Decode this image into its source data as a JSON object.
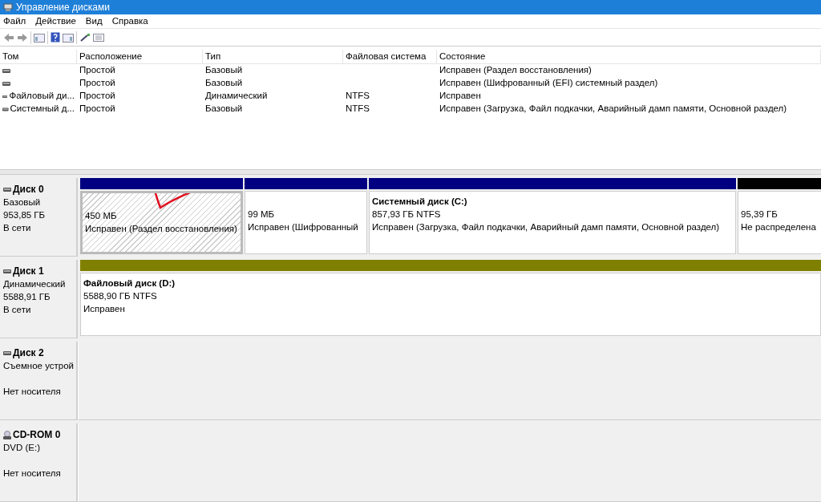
{
  "window": {
    "title": "Управление дисками"
  },
  "menu": [
    "Файл",
    "Действие",
    "Вид",
    "Справка"
  ],
  "table": {
    "columns": [
      "Том",
      "Расположение",
      "Тип",
      "Файловая система",
      "Состояние"
    ],
    "rows": [
      {
        "cells": [
          null,
          "Простой",
          "Базовый",
          null,
          "Исправен (Раздел восстановления)"
        ]
      },
      {
        "cells": [
          null,
          "Простой",
          "Базовый",
          null,
          "Исправен (Шифрованный (EFI) системный раздел)"
        ]
      },
      {
        "cells": [
          "Файловый ди...",
          "Простой",
          "Динамический",
          "NTFS",
          "Исправен"
        ]
      },
      {
        "cells": [
          "Системный д...",
          "Простой",
          "Базовый",
          "NTFS",
          "Исправен (Загрузка, Файл подкачки, Аварийный дамп памяти, Основной раздел)"
        ]
      }
    ]
  },
  "disks": [
    {
      "kind": "disk",
      "name": "Диск 0",
      "type": "Базовый",
      "size": "953,85 ГБ",
      "status": "В сети",
      "partitions": [
        {
          "color": "#000080",
          "selected": true,
          "annotated": true,
          "lines": [
            "450 МБ",
            "Исправен (Раздел восстановления)"
          ]
        },
        {
          "color": "#000080",
          "selected": false,
          "annotated": false,
          "lines": [
            "99 МБ",
            "Исправен (Шифрованный"
          ]
        },
        {
          "color": "#000080",
          "selected": false,
          "annotated": false,
          "title": "Системный диск  (C:)",
          "lines": [
            "857,93 ГБ NTFS",
            "Исправен (Загрузка, Файл подкачки, Аварийный дамп памяти, Основной раздел)"
          ]
        },
        {
          "color": "#000000",
          "selected": false,
          "annotated": false,
          "lines": [
            "95,39 ГБ",
            "Не распределена"
          ]
        }
      ]
    },
    {
      "kind": "disk",
      "name": "Диск 1",
      "type": "Динамический",
      "size": "5588,91 ГБ",
      "status": "В сети",
      "partitions": [
        {
          "color": "#808000",
          "selected": false,
          "annotated": false,
          "title": "Файловый диск  (D:)",
          "lines": [
            "5588,90 ГБ NTFS",
            "Исправен"
          ]
        }
      ]
    },
    {
      "kind": "disk",
      "name": "Диск 2",
      "type": "Съемное устрой",
      "status": "Нет носителя"
    },
    {
      "kind": "cdrom",
      "name": "CD-ROM 0",
      "type": "DVD (E:)",
      "status": "Нет носителя"
    }
  ]
}
